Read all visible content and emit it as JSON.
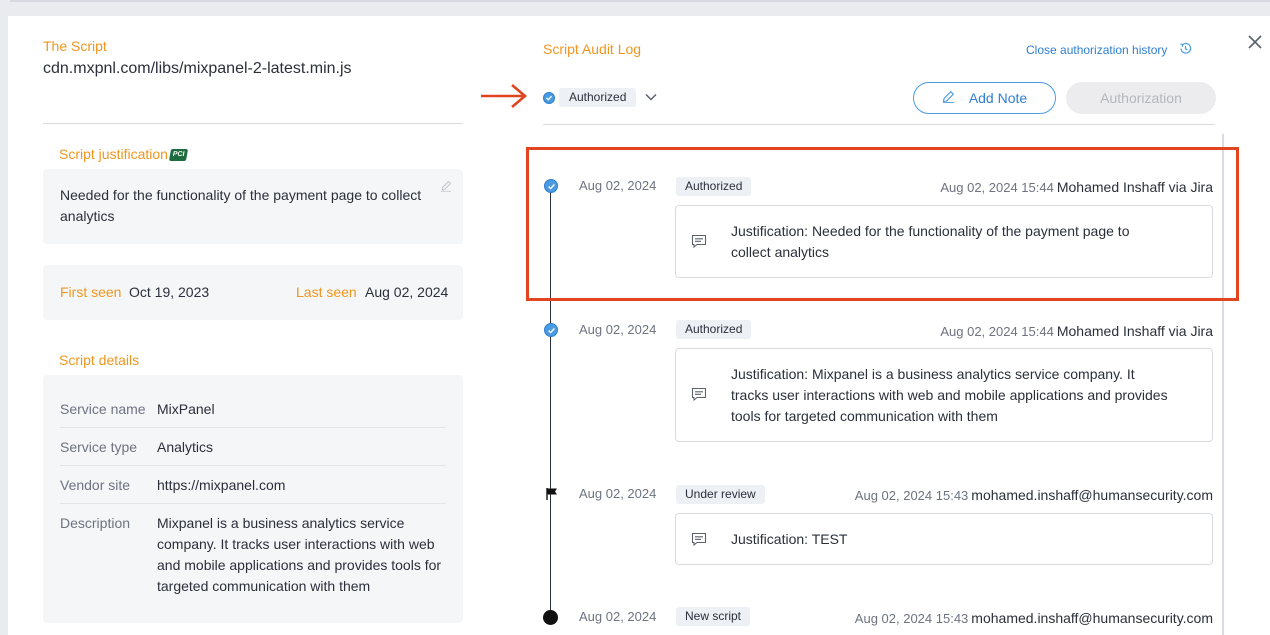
{
  "script": {
    "section_label": "The Script",
    "url": "cdn.mxpnl.com/libs/mixpanel-2-latest.min.js"
  },
  "justification": {
    "label": "Script justification",
    "badge": "PCI",
    "text": "Needed for the functionality of the payment page to collect analytics"
  },
  "seen": {
    "first_label": "First seen",
    "first_value": "Oct 19, 2023",
    "last_label": "Last seen",
    "last_value": "Aug 02, 2024"
  },
  "details": {
    "label": "Script details",
    "rows": [
      {
        "label": "Service name",
        "value": "MixPanel"
      },
      {
        "label": "Service type",
        "value": "Analytics"
      },
      {
        "label": "Vendor site",
        "value": "https://mixpanel.com"
      },
      {
        "label": "Description",
        "value": "Mixpanel is a business analytics service company. It tracks user interactions with web and mobile applications and provides tools for targeted communication with them"
      }
    ]
  },
  "audit": {
    "title": "Script Audit Log",
    "close_history": "Close authorization history",
    "status": "Authorized",
    "add_note": "Add Note",
    "authorization": "Authorization",
    "events": [
      {
        "date": "Aug 02, 2024",
        "badge": "Authorized",
        "timestamp": "Aug 02, 2024 15:44",
        "user": "Mohamed Inshaff via Jira",
        "justification_label": "Justification:",
        "justification": "Needed for the functionality of the payment page to collect analytics",
        "marker": "check"
      },
      {
        "date": "Aug 02, 2024",
        "badge": "Authorized",
        "timestamp": "Aug 02, 2024 15:44",
        "user": "Mohamed Inshaff via Jira",
        "justification_label": "Justification:",
        "justification": "Mixpanel is a business analytics service company. It tracks user interactions with web and mobile applications and provides tools for targeted communication with them",
        "marker": "check"
      },
      {
        "date": "Aug 02, 2024",
        "badge": "Under review",
        "timestamp": "Aug 02, 2024 15:43",
        "user": "mohamed.inshaff@humansecurity.com",
        "justification_label": "Justification:",
        "justification": "TEST",
        "marker": "flag"
      },
      {
        "date": "Aug 02, 2024",
        "badge": "New script",
        "timestamp": "Aug 02, 2024 15:43",
        "user": "mohamed.inshaff@humansecurity.com",
        "marker": "dot"
      }
    ]
  },
  "colors": {
    "accent_orange": "#f0961e",
    "accent_blue": "#4a9be0",
    "annotation_red": "#e0451f"
  },
  "icons": [
    "close-icon",
    "history-icon",
    "pencil-icon",
    "comment-icon",
    "check-icon",
    "flag-icon",
    "chevron-down-icon",
    "arrow-right-icon"
  ]
}
